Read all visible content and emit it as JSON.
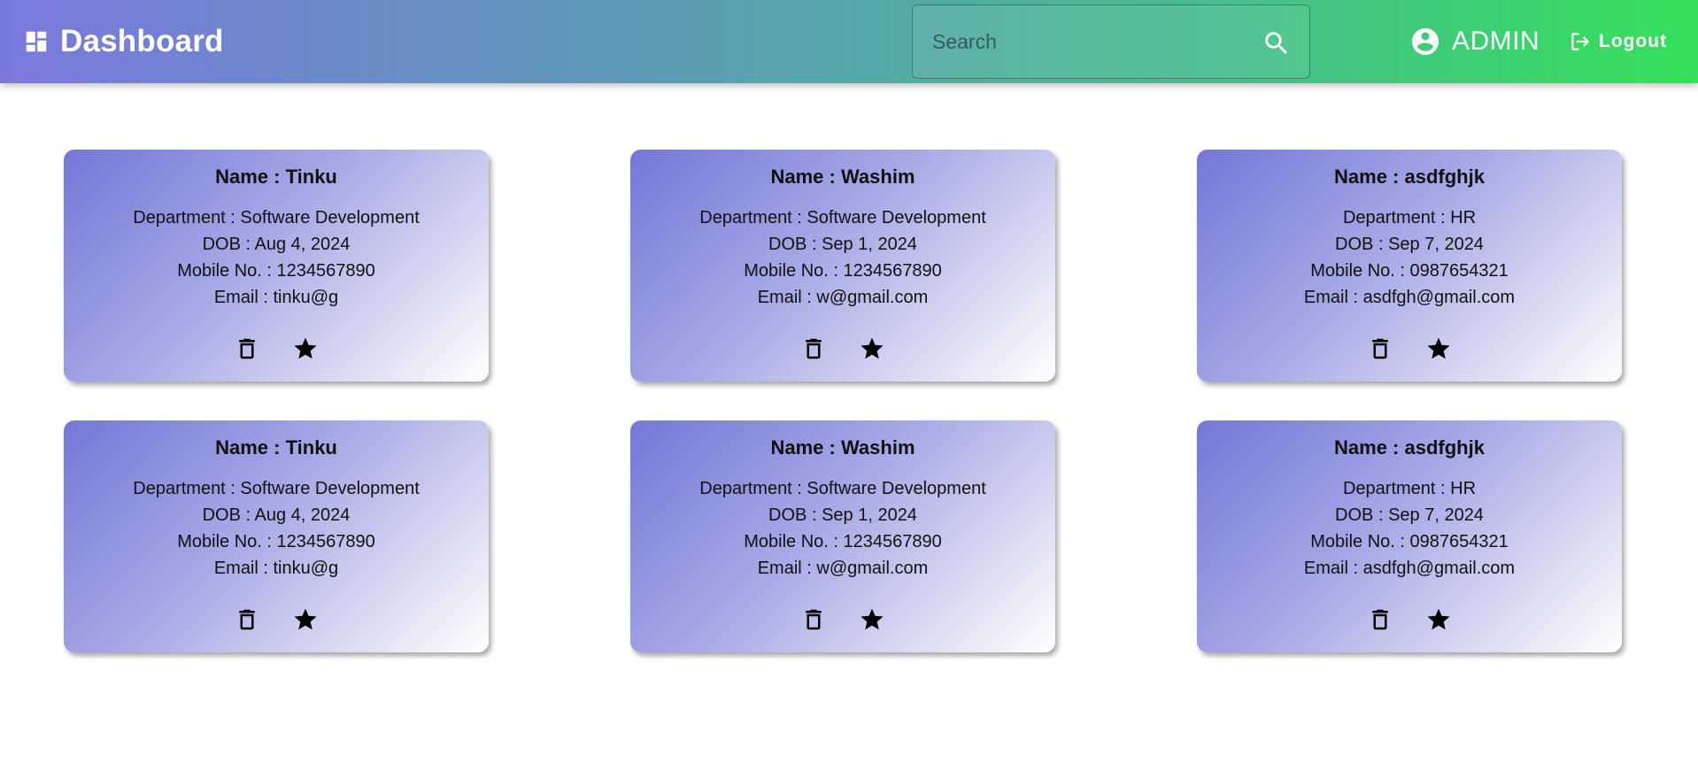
{
  "appbar": {
    "title": "Dashboard",
    "search_placeholder": "Search",
    "user_name": "ADMIN",
    "logout_label": "Logout"
  },
  "labels": {
    "name": "Name : ",
    "department": "Department : ",
    "dob": "DOB : ",
    "mobile": "Mobile No. : ",
    "email": "Email : "
  },
  "cards": [
    {
      "name": "Tinku",
      "department": "Software Development",
      "dob": "Aug 4, 2024",
      "mobile": "1234567890",
      "email": "tinku@g"
    },
    {
      "name": "Washim",
      "department": "Software Development",
      "dob": "Sep 1, 2024",
      "mobile": "1234567890",
      "email": "w@gmail.com"
    },
    {
      "name": "asdfghjk",
      "department": "HR",
      "dob": "Sep 7, 2024",
      "mobile": "0987654321",
      "email": "asdfgh@gmail.com"
    },
    {
      "name": "Tinku",
      "department": "Software Development",
      "dob": "Aug 4, 2024",
      "mobile": "1234567890",
      "email": "tinku@g"
    },
    {
      "name": "Washim",
      "department": "Software Development",
      "dob": "Sep 1, 2024",
      "mobile": "1234567890",
      "email": "w@gmail.com"
    },
    {
      "name": "asdfghjk",
      "department": "HR",
      "dob": "Sep 7, 2024",
      "mobile": "0987654321",
      "email": "asdfgh@gmail.com"
    }
  ],
  "icons": {
    "brand": "dashboard-icon",
    "search": "search-icon",
    "user": "account-circle-icon",
    "logout": "logout-icon",
    "delete": "trash-icon",
    "favorite": "star-icon"
  },
  "colors": {
    "appbar_start": "#7b78dd",
    "appbar_end": "#35e05a",
    "card_start": "#7477d6",
    "card_end": "#ffffff"
  }
}
